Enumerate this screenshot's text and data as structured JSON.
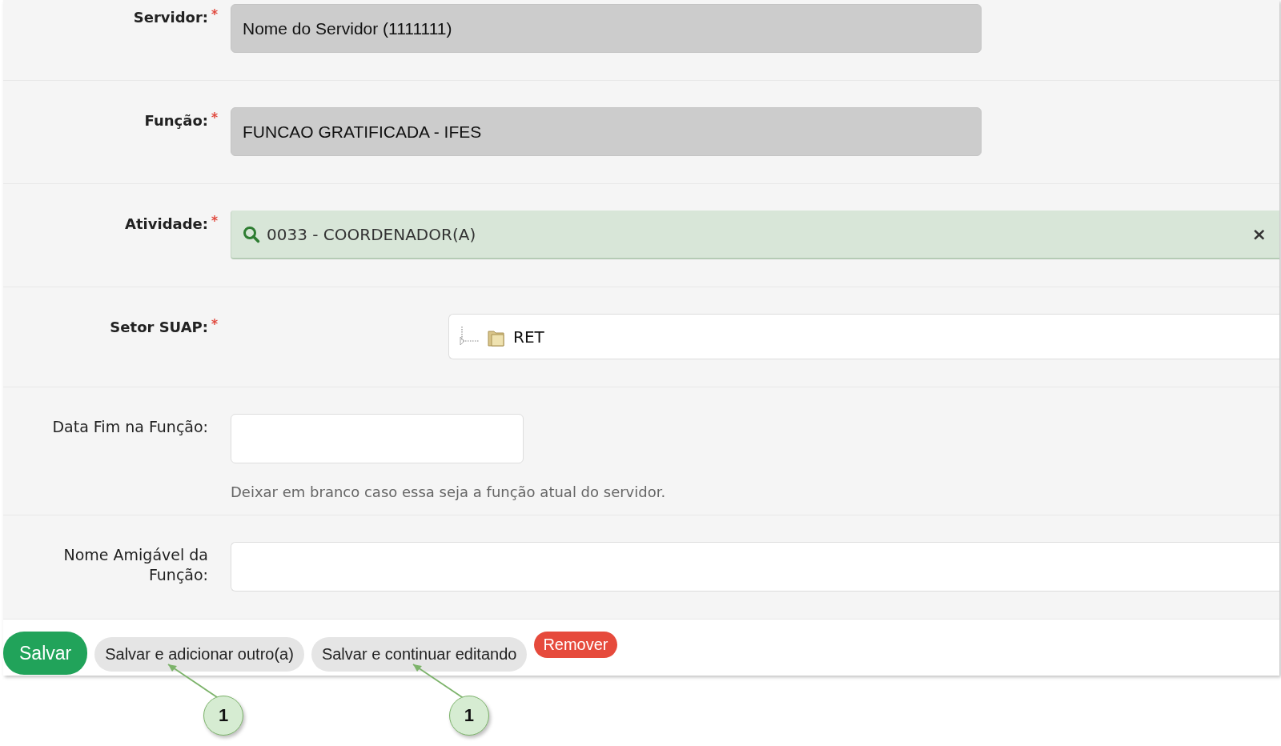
{
  "fields": [
    {
      "label": "Servidor:",
      "required": true,
      "kind": "readonly",
      "value": "Nome do Servidor (1111111)"
    },
    {
      "label": "Função:",
      "required": true,
      "kind": "readonly",
      "value": "FUNCAO GRATIFICADA - IFES"
    },
    {
      "label": "Atividade:",
      "required": true,
      "kind": "autocomplete",
      "value": "0033 - COORDENADOR(A)",
      "clear": "×"
    },
    {
      "label": "Setor SUAP:",
      "required": true,
      "kind": "tree",
      "value": "RET"
    },
    {
      "label": "Data Fim na Função:",
      "required": false,
      "kind": "date",
      "help": "Deixar em branco caso essa seja a função atual do servidor."
    },
    {
      "label": "Nome Amigável da Função:",
      "required": false,
      "kind": "text"
    }
  ],
  "buttons": [
    {
      "label": "Salvar",
      "kind": "primary"
    },
    {
      "label": "Salvar e adicionar outro(a)",
      "kind": "secondary",
      "callout": "1"
    },
    {
      "label": "Salvar e continuar editando",
      "kind": "secondary",
      "callout": "1"
    },
    {
      "label": "Remover",
      "kind": "danger"
    }
  ]
}
